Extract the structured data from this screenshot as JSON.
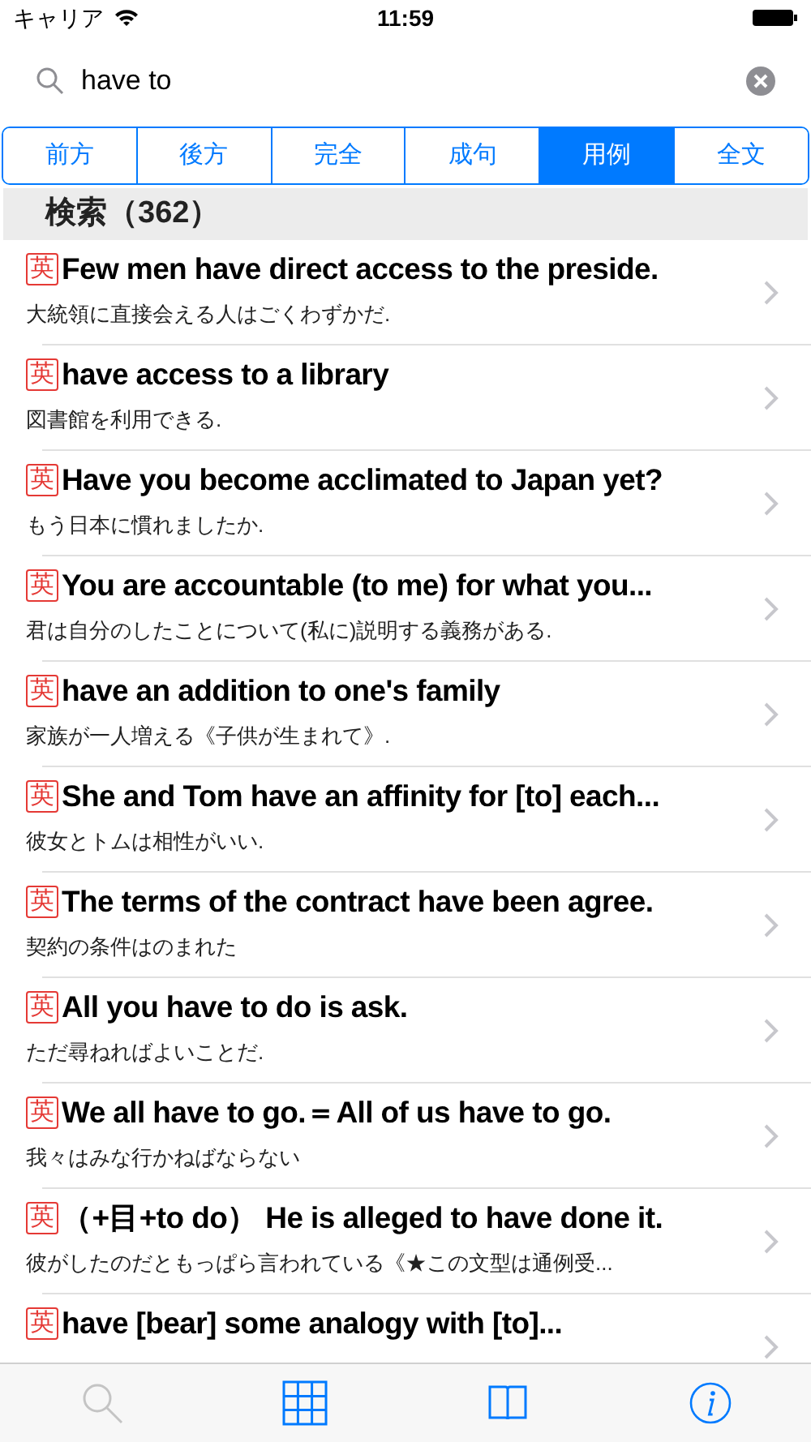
{
  "status_bar": {
    "carrier": "キャリア",
    "time": "11:59"
  },
  "search": {
    "value": "have to"
  },
  "segments": [
    {
      "label": "前方",
      "selected": false
    },
    {
      "label": "後方",
      "selected": false
    },
    {
      "label": "完全",
      "selected": false
    },
    {
      "label": "成句",
      "selected": false
    },
    {
      "label": "用例",
      "selected": true
    },
    {
      "label": "全文",
      "selected": false
    }
  ],
  "section_header": "検索（362）",
  "rows": [
    {
      "badge": "英",
      "title": "Few men have direct access to the preside.",
      "translation": "大統領に直接会える人はごくわずかだ."
    },
    {
      "badge": "英",
      "title": "have access to a library",
      "translation": "図書館を利用できる."
    },
    {
      "badge": "英",
      "title": "Have you become acclimated to Japan yet?",
      "translation": "もう日本に慣れましたか."
    },
    {
      "badge": "英",
      "title": "You are accountable (to me) for what you...",
      "translation": "君は自分のしたことについて(私に)説明する義務がある."
    },
    {
      "badge": "英",
      "title": "have an addition to one's family",
      "translation": "家族が一人増える《子供が生まれて》."
    },
    {
      "badge": "英",
      "title": "She and Tom have an affinity for [to] each...",
      "translation": "彼女とトムは相性がいい."
    },
    {
      "badge": "英",
      "title": "The terms of the contract have been agree.",
      "translation": "契約の条件はのまれた"
    },
    {
      "badge": "英",
      "title": "All you have to do is ask.",
      "translation": "ただ尋ねればよいことだ."
    },
    {
      "badge": "英",
      "title": "We all have to go.＝All of us have to go.",
      "translation": "我々はみな行かねばならない"
    },
    {
      "badge": "英",
      "title": "（+目+to do） He is alleged to have done it.",
      "translation": "彼がしたのだともっぱら言われている《★この文型は通例受..."
    },
    {
      "badge": "英",
      "title": "have [bear] some analogy with [to]..."
    }
  ],
  "tab_bar": [
    {
      "kind": "search",
      "disabled": true
    },
    {
      "kind": "grid",
      "disabled": false
    },
    {
      "kind": "book",
      "disabled": false
    },
    {
      "kind": "info",
      "disabled": false
    }
  ]
}
